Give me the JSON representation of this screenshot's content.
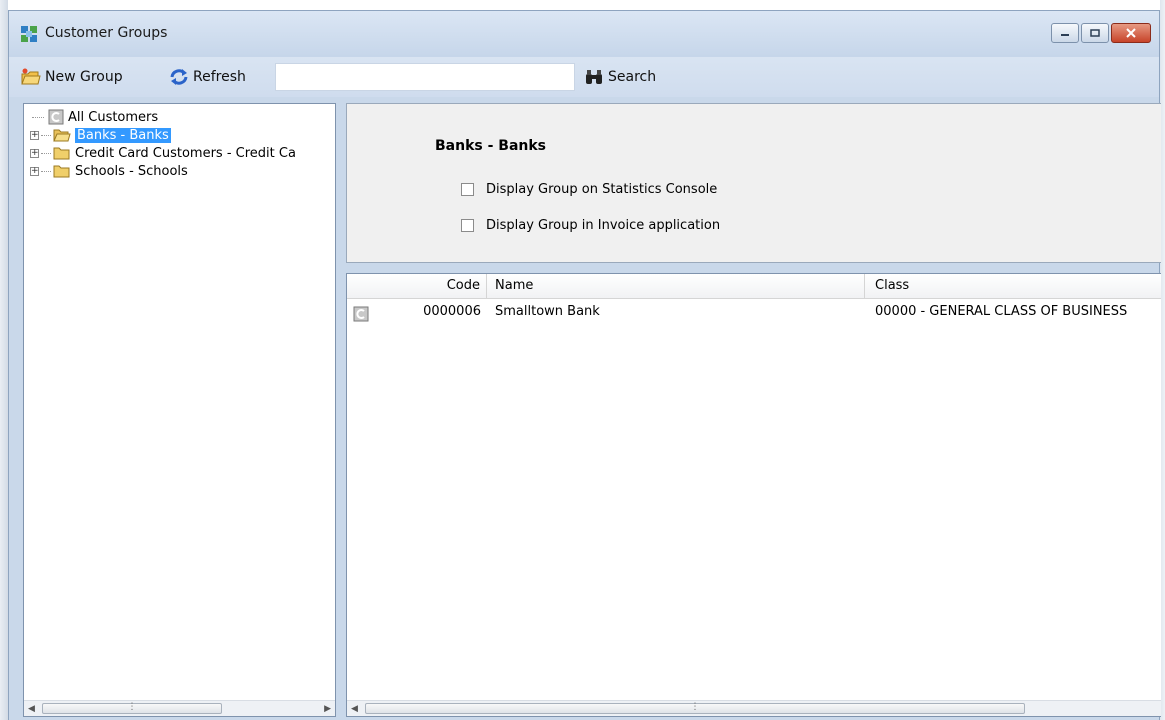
{
  "window": {
    "title": "Customer Groups"
  },
  "toolbar": {
    "new_group_label": "New Group",
    "refresh_label": "Refresh",
    "search_value": "",
    "search_label": "Search"
  },
  "tree": {
    "items": [
      {
        "label": "All Customers"
      },
      {
        "label": "Banks - Banks"
      },
      {
        "label": "Credit Card Customers - Credit Ca"
      },
      {
        "label": "Schools - Schools"
      }
    ]
  },
  "detail": {
    "group_title": "Banks - Banks",
    "display_statistics_label": "Display Group on Statistics Console",
    "display_invoice_label": "Display Group in Invoice application"
  },
  "grid": {
    "columns": [
      "Code",
      "Name",
      "Class"
    ],
    "rows": [
      {
        "code": "0000006",
        "name": "Smalltown Bank",
        "class": "00000 - GENERAL CLASS OF BUSINESS"
      }
    ]
  },
  "colors": {
    "selection": "#3399ff",
    "titlebar": "#c6d6ea",
    "close_button": "#c7442a"
  }
}
